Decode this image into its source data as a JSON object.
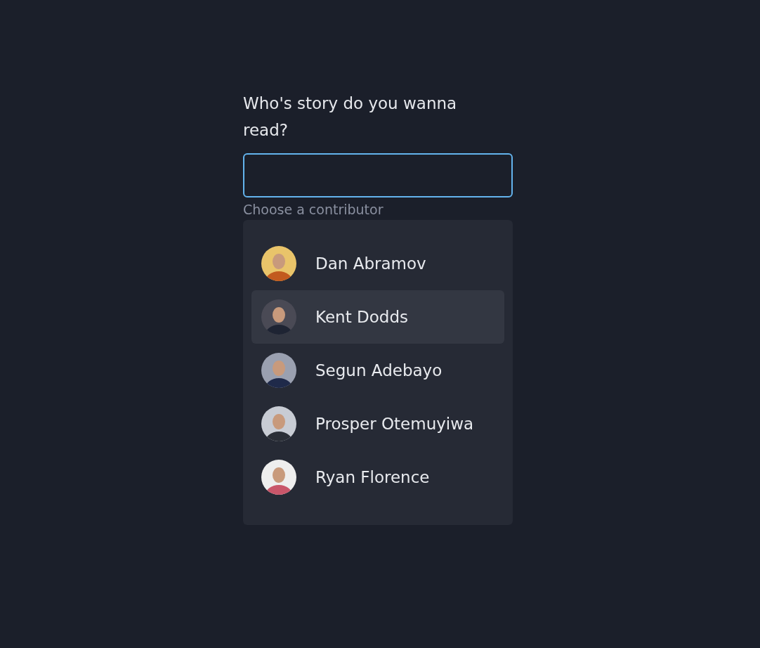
{
  "form": {
    "label": "Who's story do you wanna read?",
    "input": {
      "focused": true
    },
    "hint": "Choose a contributor"
  },
  "options": [
    {
      "name": "Dan Abramov",
      "selected": false
    },
    {
      "name": "Kent Dodds",
      "selected": true
    },
    {
      "name": "Segun Adebayo",
      "selected": false
    },
    {
      "name": "Prosper Otemuyiwa",
      "selected": false
    },
    {
      "name": "Ryan Florence",
      "selected": false
    }
  ]
}
